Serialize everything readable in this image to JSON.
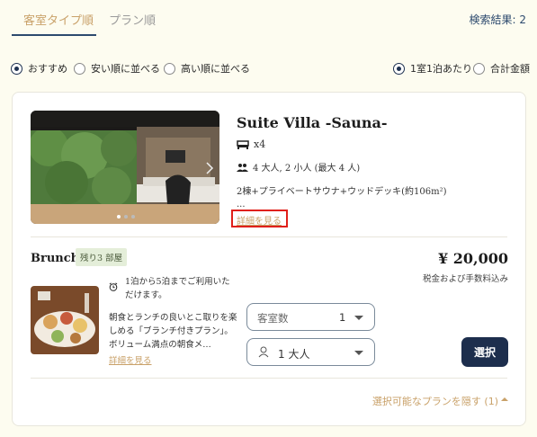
{
  "tabs": [
    {
      "label": "客室タイプ順",
      "active": true
    },
    {
      "label": "プラン順",
      "active": false
    }
  ],
  "result_count": "検索結果: 2",
  "sort_options": [
    {
      "label": "おすすめ",
      "checked": true
    },
    {
      "label": "安い順に並べる",
      "checked": false
    },
    {
      "label": "高い順に並べる",
      "checked": false
    }
  ],
  "price_mode_options": [
    {
      "label": "1室1泊あたり",
      "checked": true
    },
    {
      "label": "合計金額",
      "checked": false
    }
  ],
  "room": {
    "title": "Suite Villa -Sauna-",
    "beds": "x4",
    "capacity": "4 大人, 2 小人 (最大 4 人)",
    "description": "2棟+プライベートサウナ+ウッドデッキ(約106m²)",
    "ellipsis": "...",
    "detail_link": "詳細を見る"
  },
  "plan": {
    "title": "Brunch",
    "remaining": "残り3 部屋",
    "price": "¥ 20,000",
    "price_note": "税金および手数料込み",
    "stay_note": "1泊から5泊までご利用いただけます。",
    "description": "朝食とランチの良いとこ取りを楽しめる「ブランチ付きプラン」。ボリューム満点の朝食メ…",
    "detail_link": "詳細を見る",
    "room_count_label": "客室数",
    "room_count_value": "1",
    "guests_value": "1 大人",
    "select_button": "選択"
  },
  "hide_plans_label": "選択可能なプランを隠す (1)",
  "colors": {
    "background": "#fdfcf0",
    "accent_gold": "#c9a169",
    "navy": "#1d2e4d",
    "highlight_red": "#e0201a"
  }
}
